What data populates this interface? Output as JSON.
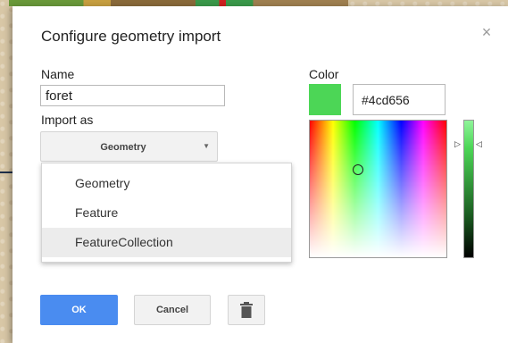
{
  "dialog": {
    "title": "Configure geometry import",
    "close_glyph": "×"
  },
  "form": {
    "name_label": "Name",
    "name_value": "foret",
    "import_label": "Import as",
    "import_selected": "Geometry",
    "import_options": [
      "Geometry",
      "Feature",
      "FeatureCollection"
    ],
    "import_highlighted": "FeatureCollection"
  },
  "color": {
    "label": "Color",
    "hex_value": "#4cd656"
  },
  "buttons": {
    "ok_label": "OK",
    "cancel_label": "Cancel"
  },
  "icons": {
    "close": "close-icon",
    "dropdown": "chevron-down-icon",
    "delete": "trash-icon",
    "pointer": "arrow-right-icon"
  }
}
